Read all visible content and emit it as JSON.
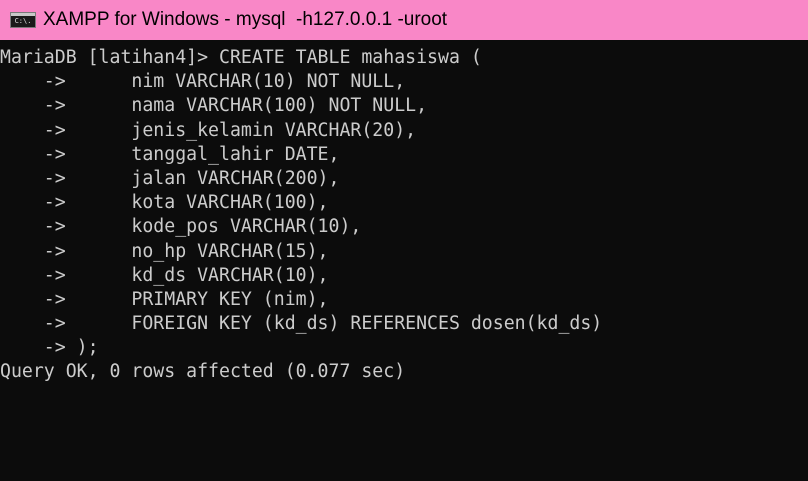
{
  "window": {
    "title": "XAMPP for Windows - mysql  -h127.0.0.1 -uroot",
    "icon_label": "C:\\.",
    "icon_name": "console-icon",
    "titlebar_color": "#f987c7",
    "background_color": "#0c0c0c",
    "text_color": "#cccccc"
  },
  "console": {
    "lines": [
      "MariaDB [latihan4]> CREATE TABLE mahasiswa (",
      "    ->      nim VARCHAR(10) NOT NULL,",
      "    ->      nama VARCHAR(100) NOT NULL,",
      "    ->      jenis_kelamin VARCHAR(20),",
      "    ->      tanggal_lahir DATE,",
      "    ->      jalan VARCHAR(200),",
      "    ->      kota VARCHAR(100),",
      "    ->      kode_pos VARCHAR(10),",
      "    ->      no_hp VARCHAR(15),",
      "    ->      kd_ds VARCHAR(10),",
      "    ->      PRIMARY KEY (nim),",
      "    ->      FOREIGN KEY (kd_ds) REFERENCES dosen(kd_ds)",
      "    -> );",
      "Query OK, 0 rows affected (0.077 sec)"
    ]
  }
}
